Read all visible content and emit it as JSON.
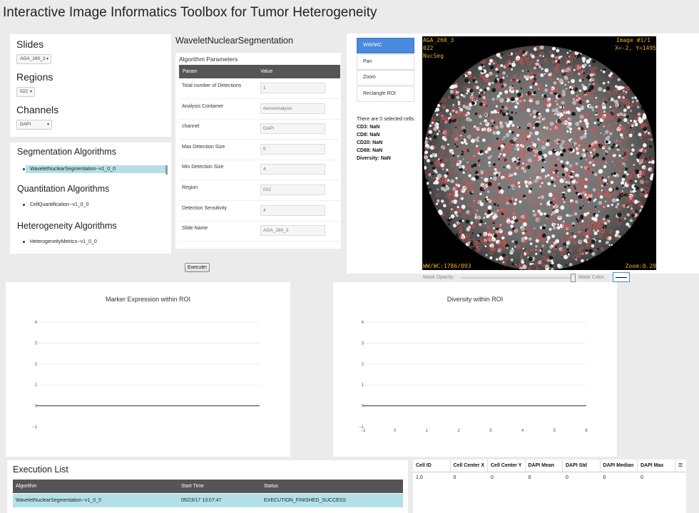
{
  "app": {
    "title": "Interactive Image Informatics Toolbox for Tumor Heterogeneity"
  },
  "sidebar": {
    "slides_label": "Slides",
    "slides_value": "AGA_260_3",
    "regions_label": "Regions",
    "regions_value": "022",
    "channels_label": "Channels",
    "channels_value": "DAPI"
  },
  "algorithms": {
    "segmentation_header": "Segmentation Algorithms",
    "segmentation_items": [
      "WaveletNuclearSegmentation--v1_0_0"
    ],
    "quantitation_header": "Quantitation Algorithms",
    "quantitation_items": [
      "CellQuantification--v1_0_0"
    ],
    "heterogeneity_header": "Heterogeneity Algorithms",
    "heterogeneity_items": [
      "HeterogeneityMetrics--v1_0_0"
    ]
  },
  "params": {
    "algorithm_title": "WaveletNuclearSegmentation",
    "section_title": "Algorithm Parameters",
    "col_param": "Param",
    "col_value": "Value",
    "rows": [
      {
        "name": "Total number of Detections",
        "value": "1"
      },
      {
        "name": "Analysis Container",
        "value": "demoAnalysis"
      },
      {
        "name": "channel",
        "value": "DAPI"
      },
      {
        "name": "Max Detection Size",
        "value": "5"
      },
      {
        "name": "Min Detection Size",
        "value": "4"
      },
      {
        "name": "Region",
        "value": "022"
      },
      {
        "name": "Detection Sensitivity",
        "value": "4"
      },
      {
        "name": "Slide Name",
        "value": "AGA_260_3"
      }
    ],
    "execute_label": "Execute!"
  },
  "viewer": {
    "tools": [
      "WW/WC",
      "Pan",
      "Zoom",
      "Rectangle ROI"
    ],
    "active_tool": "WW/WC",
    "selection_text": "There are 0 selected cells.",
    "stats": [
      {
        "label": "CD3:",
        "value": "NaN"
      },
      {
        "label": "CD8:",
        "value": "NaN"
      },
      {
        "label": "CD20:",
        "value": "NaN"
      },
      {
        "label": "CD68:",
        "value": "NaN"
      },
      {
        "label": "Diversity:",
        "value": "NaN"
      }
    ],
    "overlay_tl_1": "AGA_260_3",
    "overlay_tl_2": "022",
    "overlay_tl_3": "NucSeg",
    "overlay_tr_1": "Image #1/1",
    "overlay_tr_2": "X=-2, Y=1495",
    "overlay_bl": "WW/WC:1786/893",
    "overlay_br": "Zoom:0.29",
    "mask_opacity_label": "Mask Opacity:",
    "mask_opacity_value": 1.0,
    "mask_color_label": "Mask Color:"
  },
  "chart_data": [
    {
      "type": "line",
      "title": "Marker Expression within ROI",
      "y_ticks": [
        "4",
        "3",
        "2",
        "1",
        "0",
        "−1"
      ],
      "x_ticks": [],
      "ylim": [
        -1,
        4
      ],
      "series": []
    },
    {
      "type": "line",
      "title": "Diversity within ROI",
      "y_ticks": [
        "4",
        "3",
        "2",
        "1",
        "0",
        "−1"
      ],
      "x_ticks": [
        "−1",
        "0",
        "1",
        "2",
        "3",
        "4",
        "5",
        "6"
      ],
      "xlim": [
        -1,
        6
      ],
      "ylim": [
        -1,
        4
      ],
      "series": []
    }
  ],
  "execution": {
    "title": "Execution List",
    "columns": [
      "Algorithm",
      "Start Time",
      "Status"
    ],
    "rows": [
      {
        "algorithm": "WaveletNuclearSegmentation--v1_0_0",
        "start": "05/23/17 13:07:47",
        "status": "EXECUTION_FINISHED_SUCCESS"
      }
    ]
  },
  "grid": {
    "columns": [
      "Cell ID",
      "Cell Center X",
      "Cell Center Y",
      "DAPI Mean",
      "DAPI Std",
      "DAPI Median",
      "DAPI Max"
    ],
    "rows": [
      [
        "1.0",
        "0",
        "0",
        "0",
        "0",
        "0",
        "0"
      ]
    ]
  },
  "colors": {
    "accent": "#4a89dc",
    "header": "#555555",
    "row_highlight": "#b3e0e7",
    "overlay_text": "#e8b020",
    "cell_mask": "#e05050"
  }
}
